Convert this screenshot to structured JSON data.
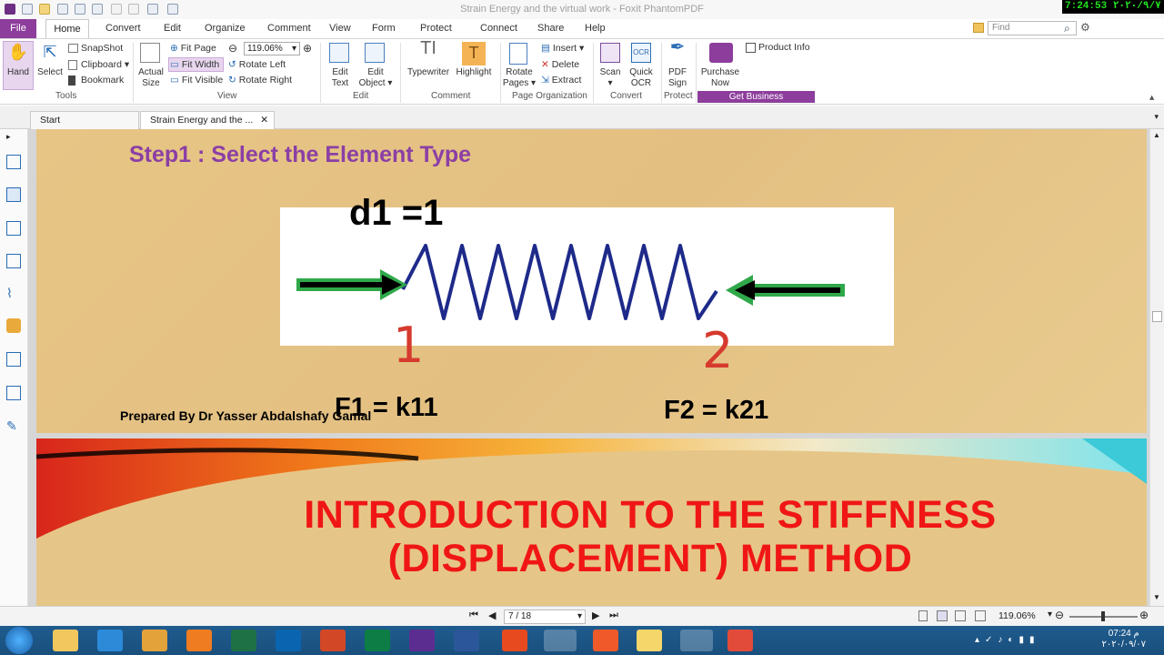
{
  "window": {
    "title": "Strain Energy and the virtual work - Foxit PhantomPDF",
    "clock": "7:24:53 ٢٠٢٠/٩/٧"
  },
  "menu": {
    "file": "File",
    "items": [
      "Home",
      "Convert",
      "Edit",
      "Organize",
      "Comment",
      "View",
      "Form",
      "Protect",
      "Connect",
      "Share",
      "Help"
    ],
    "find_placeholder": "Find"
  },
  "ribbon": {
    "tools": {
      "hand": "Hand",
      "select": "Select",
      "snapshot": "SnapShot",
      "clipboard": "Clipboard",
      "bookmark": "Bookmark",
      "group": "Tools"
    },
    "view": {
      "actual_size_1": "Actual",
      "actual_size_2": "Size",
      "fit_page": "Fit Page",
      "fit_width": "Fit Width",
      "fit_visible": "Fit Visible",
      "zoom": "119.06%",
      "rotate_left": "Rotate Left",
      "rotate_right": "Rotate Right",
      "group": "View"
    },
    "edit": {
      "edit_text_1": "Edit",
      "edit_text_2": "Text",
      "edit_object_1": "Edit",
      "edit_object_2": "Object",
      "group": "Edit"
    },
    "comment": {
      "typewriter": "Typewriter",
      "highlight": "Highlight",
      "group": "Comment"
    },
    "page_org": {
      "rotate_pages_1": "Rotate",
      "rotate_pages_2": "Pages",
      "insert": "Insert",
      "delete": "Delete",
      "extract": "Extract",
      "group": "Page Organization"
    },
    "convert": {
      "scan": "Scan",
      "quick_ocr_1": "Quick",
      "quick_ocr_2": "OCR",
      "group": "Convert"
    },
    "protect": {
      "pdf_sign_1": "PDF",
      "pdf_sign_2": "Sign",
      "group": "Protect"
    },
    "business": {
      "purchase_1": "Purchase",
      "purchase_2": "Now",
      "product_info": "Product Info",
      "group": "Get Business"
    }
  },
  "tabs": {
    "start": "Start",
    "document": "Strain Energy and the ..."
  },
  "slide1": {
    "heading": "Step1 : Select the Element Type",
    "displacement": "d1 =1",
    "node1": "1",
    "node2": "2",
    "force1": "F1 = k11",
    "force2": "F2 = k21",
    "author": "Prepared By Dr Yasser Abdalshafy Gamal"
  },
  "slide2": {
    "title_line1": "INTRODUCTION TO THE STIFFNESS",
    "title_line2": "(DISPLACEMENT) METHOD"
  },
  "status": {
    "page": "7 / 18",
    "zoom": "119.06%"
  },
  "taskbar": {
    "time": "07:24 م",
    "date": "٢٠٢٠/٠٩/٠٧"
  }
}
